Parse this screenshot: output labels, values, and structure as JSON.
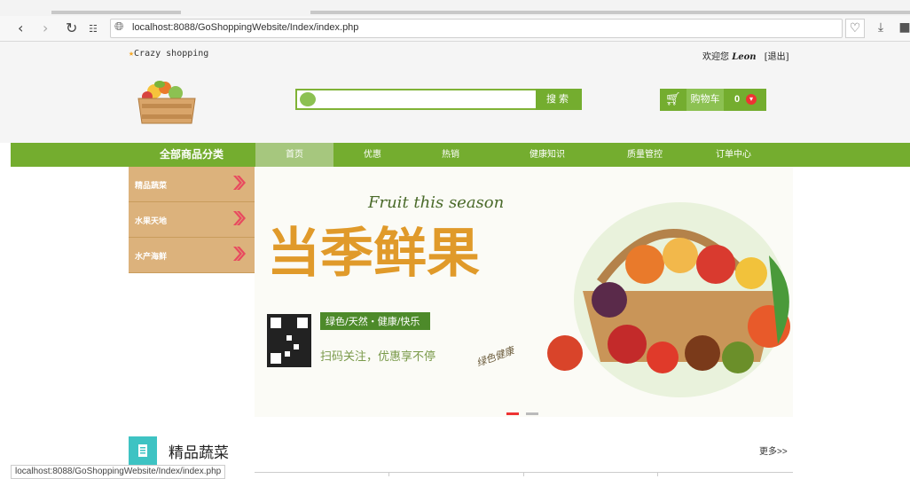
{
  "browser": {
    "url": "localhost:8088/GoShoppingWebsite/Index/index.php",
    "status_url": "localhost:8088/GoShoppingWebsite/Index/index.php"
  },
  "topbar": {
    "brand": "Crazy shopping",
    "welcome_prefix": "欢迎您",
    "username": "Leon",
    "logout": "[退出]"
  },
  "search": {
    "button": "搜索"
  },
  "cart": {
    "label": "购物车",
    "count": "0"
  },
  "nav": {
    "all_categories": "全部商品分类",
    "items": [
      "首页",
      "优惠",
      "热销",
      "健康知识",
      "质量管控",
      "订单中心"
    ]
  },
  "categories": [
    "精品蔬菜",
    "水果天地",
    "水产海鲜"
  ],
  "banner": {
    "script_text": "Fruit this season",
    "headline": "当季鲜果",
    "tagline": "绿色/天然・健康/快乐",
    "scan_text": "扫码关注，优惠享不停",
    "calligraphy": "绿色健康"
  },
  "section": {
    "title": "精品蔬菜",
    "more": "更多>>"
  },
  "colors": {
    "nav_green": "#74ad2f",
    "category_tan": "#dcb27c",
    "section_teal": "#3ec3c3"
  }
}
